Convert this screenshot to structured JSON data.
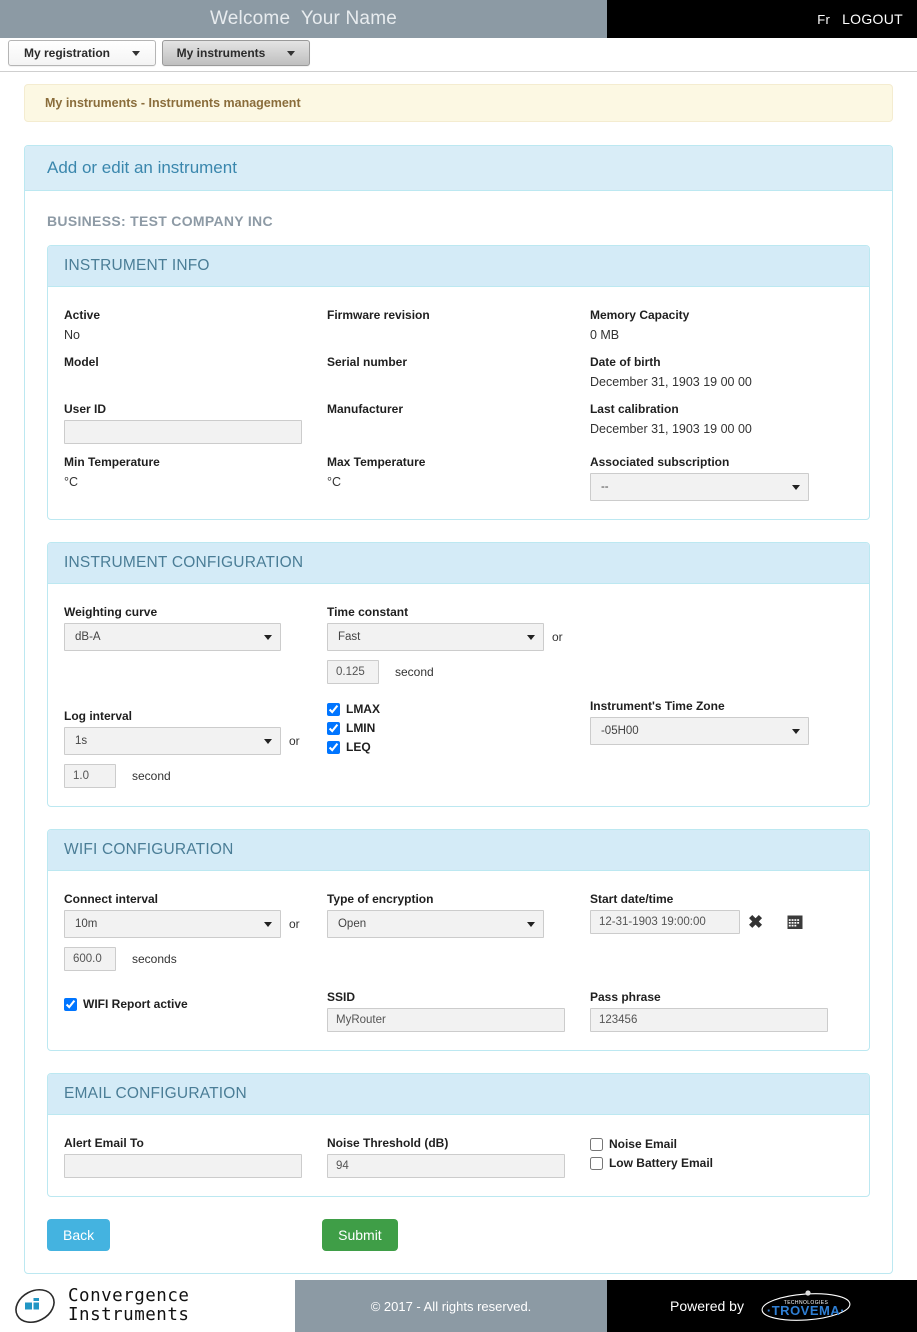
{
  "topbar": {
    "welcome": "Welcome  Your Name",
    "lang_label": "Fr",
    "logout_label": "LOGOUT"
  },
  "nav": {
    "tabs": [
      {
        "label": "My registration",
        "active": false
      },
      {
        "label": "My instruments",
        "active": true
      }
    ]
  },
  "breadcrumb": {
    "text": "My instruments - Instruments management"
  },
  "panel": {
    "heading": "Add or edit an instrument",
    "business_title": "BUSINESS: TEST COMPANY INC"
  },
  "instrument_info": {
    "heading": "INSTRUMENT INFO",
    "active_label": "Active",
    "active_value": "No",
    "firmware_label": "Firmware revision",
    "firmware_value": "",
    "memory_label": "Memory Capacity",
    "memory_value": "0 MB",
    "model_label": "Model",
    "model_value": "",
    "serial_label": "Serial number",
    "serial_value": "",
    "dob_label": "Date of birth",
    "dob_value": "December 31, 1903 19 00 00",
    "userid_label": "User ID",
    "userid_value": "",
    "manufacturer_label": "Manufacturer",
    "manufacturer_value": "",
    "lastcal_label": "Last calibration",
    "lastcal_value": "December 31, 1903 19 00 00",
    "mintemp_label": "Min Temperature",
    "mintemp_value": "°C",
    "maxtemp_label": "Max Temperature",
    "maxtemp_value": "°C",
    "subscription_label": "Associated subscription",
    "subscription_value": "--"
  },
  "instrument_config": {
    "heading": "INSTRUMENT CONFIGURATION",
    "weighting_label": "Weighting curve",
    "weighting_value": "dB-A",
    "timeconst_label": "Time constant",
    "timeconst_value": "Fast",
    "timeconst_or": "or",
    "timeconst_seconds": "0.125",
    "timeconst_unit": "second",
    "loginterval_label": "Log interval",
    "loginterval_value": "1s",
    "loginterval_or": "or",
    "loginterval_seconds": "1.0",
    "loginterval_unit": "second",
    "lmax_label": "LMAX",
    "lmax_checked": true,
    "lmin_label": "LMIN",
    "lmin_checked": true,
    "leq_label": "LEQ",
    "leq_checked": true,
    "timezone_label": "Instrument's Time Zone",
    "timezone_value": "-05H00"
  },
  "wifi_config": {
    "heading": "WIFI CONFIGURATION",
    "connect_label": "Connect interval",
    "connect_value": "10m",
    "connect_or": "or",
    "connect_seconds": "600.0",
    "connect_unit": "seconds",
    "encryption_label": "Type of encryption",
    "encryption_value": "Open",
    "startdt_label": "Start date/time",
    "startdt_value": "12-31-1903 19:00:00",
    "clear_icon": "x-icon",
    "calendar_icon": "calendar-icon",
    "report_label": "WIFI Report active",
    "report_checked": true,
    "ssid_label": "SSID",
    "ssid_value": "MyRouter",
    "pass_label": "Pass phrase",
    "pass_value": "123456"
  },
  "email_config": {
    "heading": "EMAIL CONFIGURATION",
    "alert_label": "Alert Email To",
    "alert_value": "",
    "threshold_label": "Noise Threshold (dB)",
    "threshold_value": "94",
    "noise_email_label": "Noise Email",
    "noise_email_checked": false,
    "low_batt_label": "Low Battery Email",
    "low_batt_checked": false
  },
  "actions": {
    "back_label": "Back",
    "submit_label": "Submit"
  },
  "footer": {
    "company_line1": "Convergence",
    "company_line2": "Instruments",
    "copyright": "© 2017 - All rights reserved.",
    "powered_by": "Powered by",
    "partner_small": "TECHNOLOGIES",
    "partner_name": "TROVEMA"
  },
  "colors": {
    "panel_blue": "#d9edf7",
    "panel_border": "#bce8f1",
    "heading_text": "#3a87ad",
    "alert_bg": "#fcf8e3",
    "alert_text": "#8a6d3b",
    "topbar_gray": "#8c9aa4",
    "back_btn": "#44b3e0",
    "submit_btn": "#3f9e47"
  }
}
